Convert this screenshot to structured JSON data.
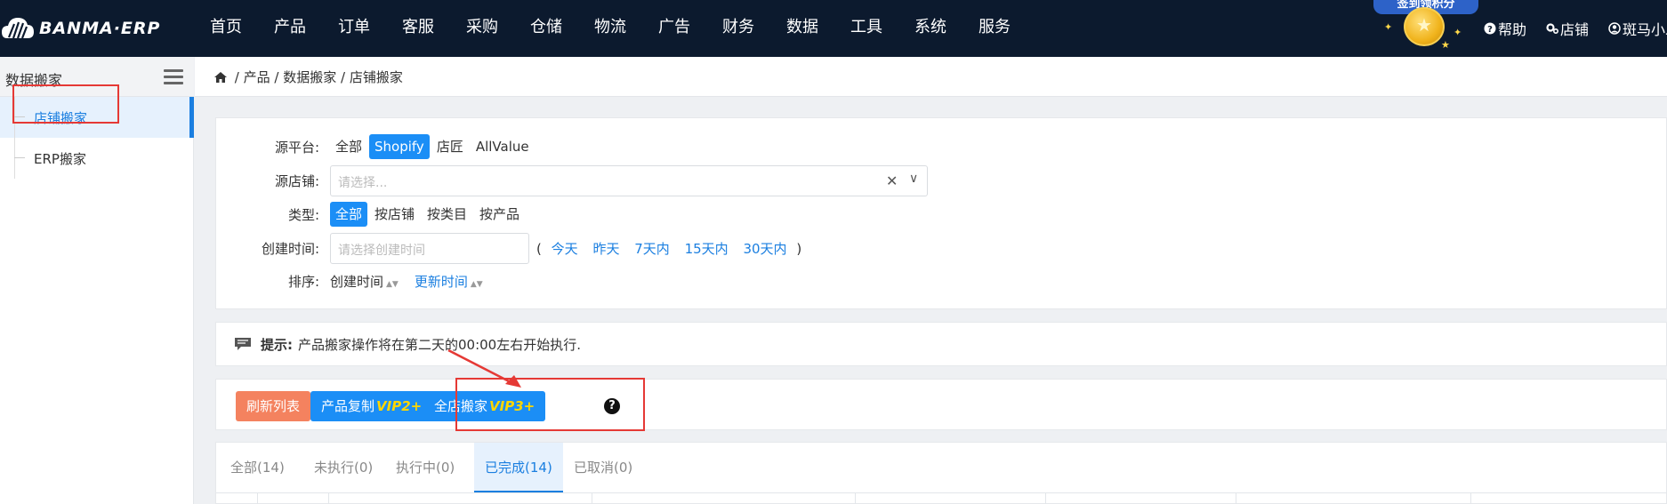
{
  "brand": {
    "name": "BANMA·ERP",
    "logo_icon": "zebra-cloud-icon"
  },
  "nav": [
    "首页",
    "产品",
    "订单",
    "客服",
    "采购",
    "仓储",
    "物流",
    "广告",
    "财务",
    "数据",
    "工具",
    "系统",
    "服务"
  ],
  "signin": {
    "label": "签到领积分"
  },
  "top_right": {
    "help": "帮助",
    "shop": "店铺",
    "user": "斑马小二"
  },
  "sidebar": {
    "title": "数据搬家",
    "items": [
      {
        "label": "店铺搬家",
        "active": true
      },
      {
        "label": "ERP搬家",
        "active": false
      }
    ]
  },
  "breadcrumb": [
    "产品",
    "数据搬家",
    "店铺搬家"
  ],
  "filter": {
    "platform_label": "源平台:",
    "platforms": [
      "全部",
      "Shopify",
      "店匠",
      "AllValue"
    ],
    "platform_selected": "Shopify",
    "store_label": "源店铺:",
    "store_placeholder": "请选择...",
    "type_label": "类型:",
    "types": [
      "全部",
      "按店铺",
      "按类目",
      "按产品"
    ],
    "type_selected": "全部",
    "created_label": "创建时间:",
    "created_placeholder": "请选择创建时间",
    "quick_open": "(",
    "quick": [
      "今天",
      "昨天",
      "7天内",
      "15天内",
      "30天内"
    ],
    "quick_close": ")",
    "sort_label": "排序:",
    "sort": [
      "创建时间",
      "更新时间"
    ]
  },
  "tip": {
    "label": "提示:",
    "text": "产品搬家操作将在第二天的00:00左右开始执行."
  },
  "actions": {
    "refresh": "刷新列表",
    "copy": "产品复制",
    "copy_vip": "VIP2+",
    "store": "全店搬家",
    "store_vip": "VIP3+",
    "help": "?"
  },
  "tabs": [
    "全部(14)",
    "未执行(0)",
    "执行中(0)",
    "已完成(14)",
    "已取消(0)"
  ],
  "tab_selected": "已完成(14)",
  "colors": {
    "topbar": "#0c1a2e",
    "primary": "#1b8ef6",
    "refresh": "#f4825f",
    "vip": "#ffd600",
    "highlight": "#e53935"
  }
}
